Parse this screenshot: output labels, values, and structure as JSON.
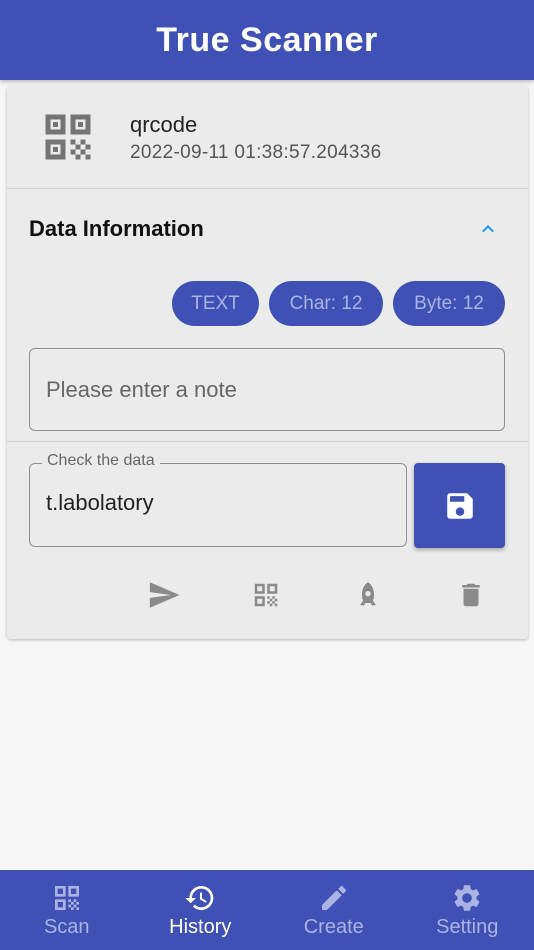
{
  "app": {
    "title": "True Scanner"
  },
  "history_item": {
    "icon": "qrcode-icon",
    "type": "qrcode",
    "datetime": "2022-09-11 01:38:57.204336"
  },
  "data_info": {
    "title": "Data Information",
    "expanded": true,
    "chips": {
      "type": "TEXT",
      "char": "Char: 12",
      "byte": "Byte: 12"
    },
    "note_placeholder": "Please enter a note",
    "note_value": "",
    "check_label": "Check the data",
    "check_value": "t.labolatory"
  },
  "actions": [
    "send-icon",
    "qrcode-icon",
    "rocket-icon",
    "delete-icon"
  ],
  "bottom_nav": {
    "items": [
      {
        "label": "Scan",
        "icon": "qr-scan-icon",
        "active": false
      },
      {
        "label": "History",
        "icon": "history-icon",
        "active": true
      },
      {
        "label": "Create",
        "icon": "pencil-icon",
        "active": false
      },
      {
        "label": "Setting",
        "icon": "gear-icon",
        "active": false
      }
    ]
  },
  "colors": {
    "primary": "#3f51b5",
    "chip_text": "#aab3e3",
    "accent": "#2196f3",
    "card_bg": "#ebebeb"
  }
}
